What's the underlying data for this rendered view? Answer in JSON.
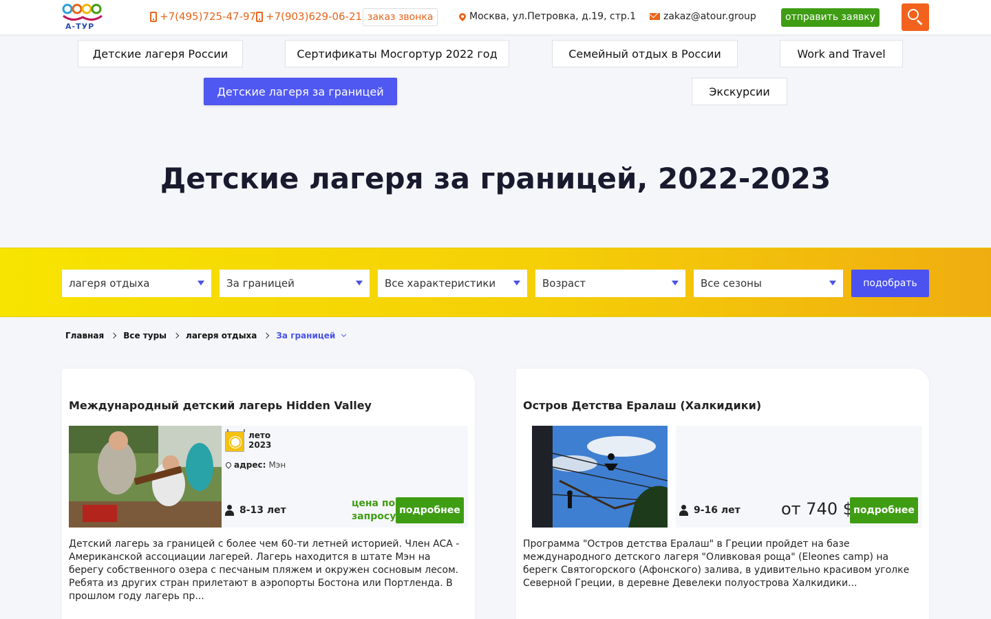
{
  "header": {
    "logo_text": "А-ТУР",
    "phone1": "+7(495)725-47-97",
    "phone2": "+7(903)629-06-21",
    "callback_label": "заказ звонка",
    "address": "Москва, ул.Петровка, д.19, стр.1",
    "email": "zakaz@atour.group",
    "send_label": "отправить заявку",
    "icons": [
      "phone-icon",
      "map-pin-icon",
      "mail-icon",
      "search-icon"
    ],
    "accent_color": "#e8641a"
  },
  "nav": {
    "items": [
      {
        "label": "Детские лагеря России"
      },
      {
        "label": "Сертификаты Мосгортур 2022 год"
      },
      {
        "label": "Семейный отдых в России"
      },
      {
        "label": "Work and Travel"
      },
      {
        "label": "Детские лагеря за границей",
        "active": true
      },
      {
        "label": "Экскурсии"
      }
    ],
    "active_color": "#5058f2"
  },
  "page_title": "Детские лагеря за границей, 2022-2023",
  "filters": {
    "selects": [
      {
        "value": "лагеря отдыха"
      },
      {
        "value": "За границей"
      },
      {
        "value": "Все характеристики"
      },
      {
        "value": "Возраст"
      },
      {
        "value": "Все сезоны"
      }
    ],
    "submit_label": "подобрать"
  },
  "breadcrumb": {
    "items": [
      "Главная",
      "Все туры",
      "лагеря отдыха",
      "За границей"
    ]
  },
  "cards": [
    {
      "title": "Международный детский лагерь Hidden Valley",
      "season_line1": "лето",
      "season_line2": "2023",
      "address_label": "адрес:",
      "address_value": "Мэн",
      "age": "8-13 лет",
      "price_line1": "цена по",
      "price_line2": "запросу",
      "more_label": "подробнее",
      "description": "Детский лагерь за границей с более чем 60-ти летней историей. Член ACA - Американской ассоциации лагерей. Лагерь находится в штате Мэн на берегу собственного озера с песчаным пляжем и окружен сосновым лесом. Ребята из других стран прилетают в аэропорты Бостона или Портленда. В прошлом году лагерь пр..."
    },
    {
      "title": "Остров Детства Ералаш (Халкидики)",
      "age": "9-16 лет",
      "price": "от 740 $",
      "more_label": "подробнее",
      "description": "Программа \"Остров детства Ералаш\" в Греции пройдет на базе международного детского лагеря \"Оливковая роща\" (Eleones camp) на берегк Святогорского (Афонского) залива, в удивительно красивом уголке Северной Греции, в деревне Девелеки  полуострова Халкидики..."
    }
  ]
}
